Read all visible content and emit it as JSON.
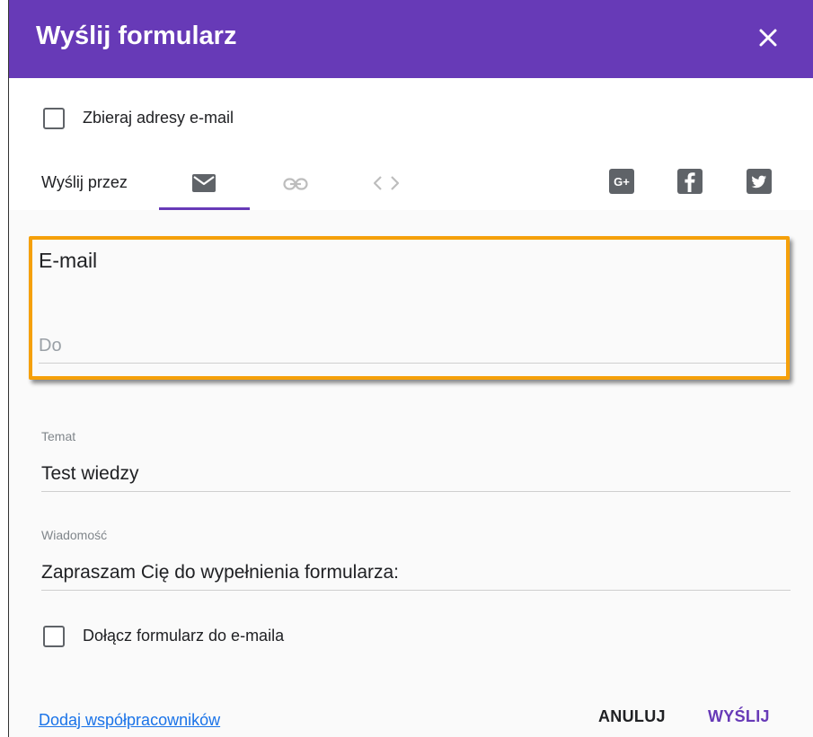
{
  "dialog": {
    "title": "Wyślij formularz",
    "close_icon": "close-icon"
  },
  "collect_emails": {
    "label": "Zbieraj adresy e-mail",
    "checked": false
  },
  "send_via": {
    "label": "Wyślij przez",
    "tabs": [
      {
        "icon": "email-icon",
        "active": true
      },
      {
        "icon": "link-icon",
        "active": false
      },
      {
        "icon": "embed-code-icon",
        "active": false
      }
    ],
    "share": [
      {
        "icon": "google-plus-icon",
        "text": "G+"
      },
      {
        "icon": "facebook-icon"
      },
      {
        "icon": "twitter-icon"
      }
    ]
  },
  "email_section": {
    "heading": "E-mail",
    "to_placeholder": "Do",
    "to_value": ""
  },
  "subject": {
    "label": "Temat",
    "value": "Test wiedzy"
  },
  "message": {
    "label": "Wiadomość",
    "value": "Zapraszam Cię do wypełnienia formularza:"
  },
  "include_form": {
    "label": "Dołącz formularz do e-maila",
    "checked": false
  },
  "footer": {
    "collaborators_link": "Dodaj współpracowników",
    "cancel_label": "ANULUJ",
    "send_label": "WYŚLIJ"
  },
  "colors": {
    "header": "#673ab7",
    "accent": "#673ab7",
    "highlight_border": "#f5a00a",
    "link": "#1a73e8"
  }
}
